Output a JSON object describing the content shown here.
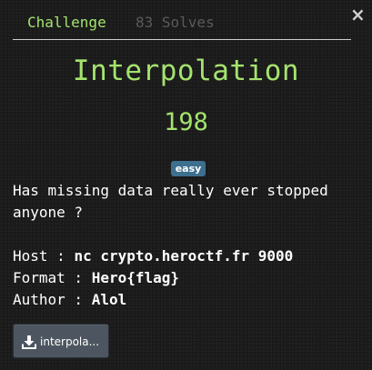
{
  "modal": {
    "close_symbol": "×",
    "tabs": [
      {
        "label": "Challenge",
        "active": true
      },
      {
        "label": "83 Solves",
        "active": false
      }
    ]
  },
  "challenge": {
    "name": "Interpolation",
    "points": "198",
    "difficulty": "easy",
    "description_lines": [
      "Has missing data really ever stopped",
      "anyone ?"
    ],
    "info": [
      {
        "label": "Host : ",
        "value": "nc crypto.heroctf.fr 9000"
      },
      {
        "label": "Format : ",
        "value": "Hero{flag}"
      },
      {
        "label": "Author : ",
        "value": "Alol"
      }
    ],
    "file": {
      "label": "interpola...",
      "icon": "download-icon"
    }
  },
  "colors": {
    "accent": "#a4e36e",
    "muted_tab": "#5a5a5a",
    "badge_bg": "#3d6f8e",
    "button_bg": "#4d5660",
    "background": "#1d1d1d"
  }
}
